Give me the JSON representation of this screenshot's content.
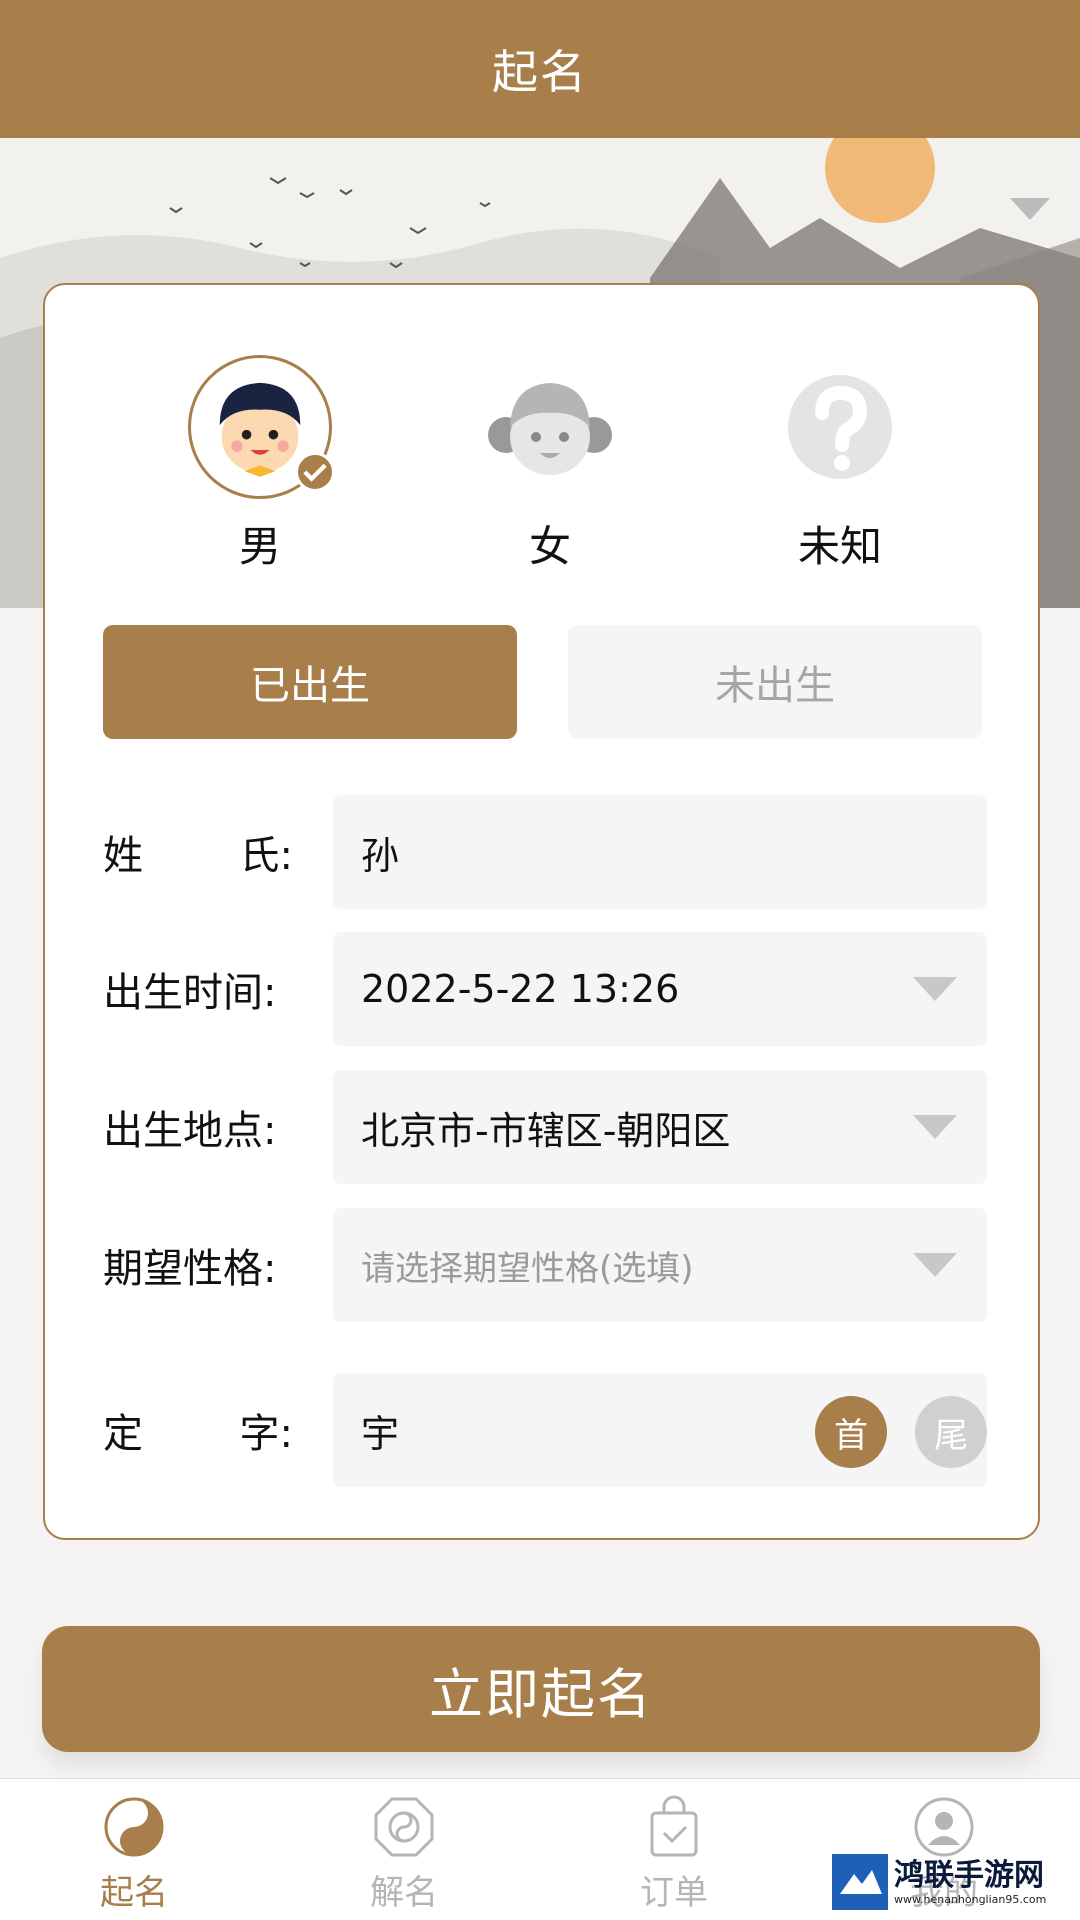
{
  "header": {
    "title": "起名"
  },
  "colors": {
    "accent": "#a87e4a",
    "field_bg": "#f5f5f5",
    "muted": "#b5b5b5"
  },
  "gender": {
    "options": [
      {
        "label": "男",
        "icon": "boy-avatar-icon",
        "selected": true
      },
      {
        "label": "女",
        "icon": "girl-avatar-icon",
        "selected": false
      },
      {
        "label": "未知",
        "icon": "question-avatar-icon",
        "selected": false
      }
    ]
  },
  "birth_status": {
    "born": "已出生",
    "unborn": "未出生",
    "selected": "已出生"
  },
  "form": {
    "surname": {
      "label_a": "姓",
      "label_b": "氏:",
      "value": "孙"
    },
    "birth_time": {
      "label": "出生时间:",
      "value": "2022-5-22 13:26"
    },
    "birth_place": {
      "label": "出生地点:",
      "value": "北京市-市辖区-朝阳区"
    },
    "personality": {
      "label": "期望性格:",
      "placeholder": "请选择期望性格(选填)"
    },
    "fixed_char": {
      "label_a": "定",
      "label_b": "字:",
      "value": "宇",
      "head": "首",
      "tail": "尾",
      "selected": "首"
    }
  },
  "submit": {
    "label": "立即起名"
  },
  "tabbar": {
    "items": [
      {
        "label": "起名",
        "icon": "yin-yang-icon",
        "active": true
      },
      {
        "label": "解名",
        "icon": "bagua-icon",
        "active": false
      },
      {
        "label": "订单",
        "icon": "shopping-bag-icon",
        "active": false
      },
      {
        "label": "我的",
        "icon": "user-icon",
        "active": false
      }
    ]
  },
  "watermark": {
    "name": "鸿联手游网",
    "url": "www.henanhonglian95.com"
  }
}
